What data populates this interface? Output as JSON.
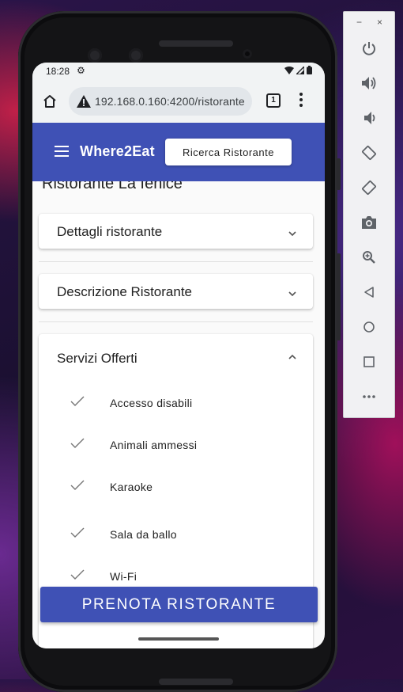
{
  "status_bar": {
    "time": "18:28"
  },
  "browser": {
    "url": "192.168.0.160:4200/ristorante",
    "tab_count": "1"
  },
  "app": {
    "brand": "Where2Eat",
    "search_button": "Ricerca Ristorante"
  },
  "restaurant": {
    "title": "Ristorante La fenice"
  },
  "panels": [
    {
      "title": "Dettagli ristorante",
      "expanded": false
    },
    {
      "title": "Descrizione Ristorante",
      "expanded": false
    },
    {
      "title": "Servizi Offerti",
      "expanded": true
    }
  ],
  "services": [
    "Accesso disabili",
    "Animali ammessi",
    "Karaoke",
    "Sala da ballo",
    "Wi-Fi"
  ],
  "book_button": "PRENOTA RISTORANTE",
  "emulator_toolbar": {
    "minimize": "−",
    "close": "×",
    "tools": [
      "power-icon",
      "volume-up-icon",
      "volume-down-icon",
      "rotate-left-icon",
      "rotate-right-icon",
      "camera-icon",
      "zoom-icon",
      "back-icon",
      "home-icon",
      "overview-icon",
      "more-icon"
    ]
  }
}
